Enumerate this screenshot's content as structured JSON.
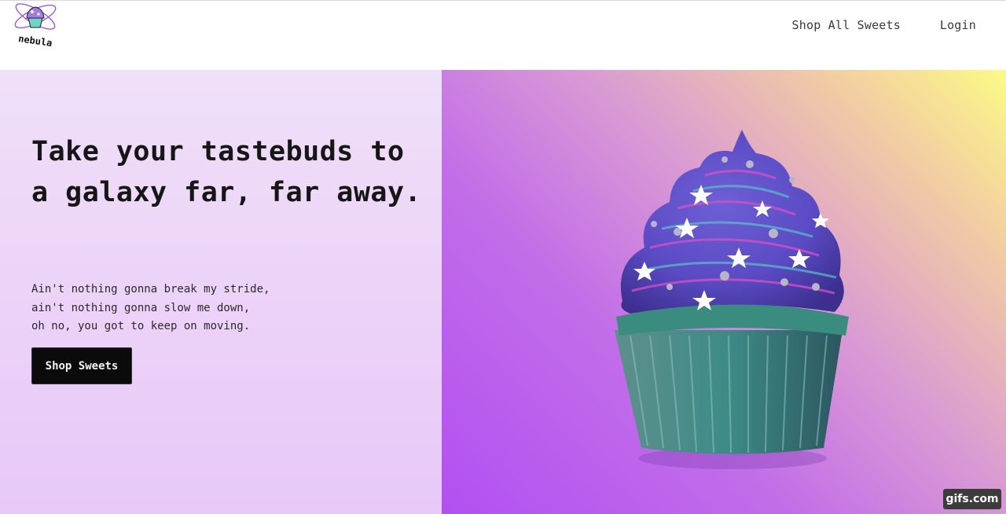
{
  "header": {
    "logo_icon": "galaxy-cupcake-logo-icon",
    "logo_text": "nebula",
    "nav": [
      {
        "label": "Shop All Sweets"
      },
      {
        "label": "Login"
      }
    ]
  },
  "hero": {
    "headline": "Take your tastebuds to a galaxy far, far away.",
    "subtext_lines": [
      "Ain't nothing gonna break my stride,",
      "ain't nothing gonna slow me down,",
      "oh no, you got to keep on moving."
    ],
    "cta_label": "Shop Sweets",
    "image_icon": "galaxy-cupcake-icon"
  },
  "watermark": "gifs.com",
  "colors": {
    "left_bg": "#ecd3f8",
    "right_gradient_start": "#fbfa86",
    "right_gradient_end": "#b34ff2",
    "cta_bg": "#0b0b0b"
  }
}
